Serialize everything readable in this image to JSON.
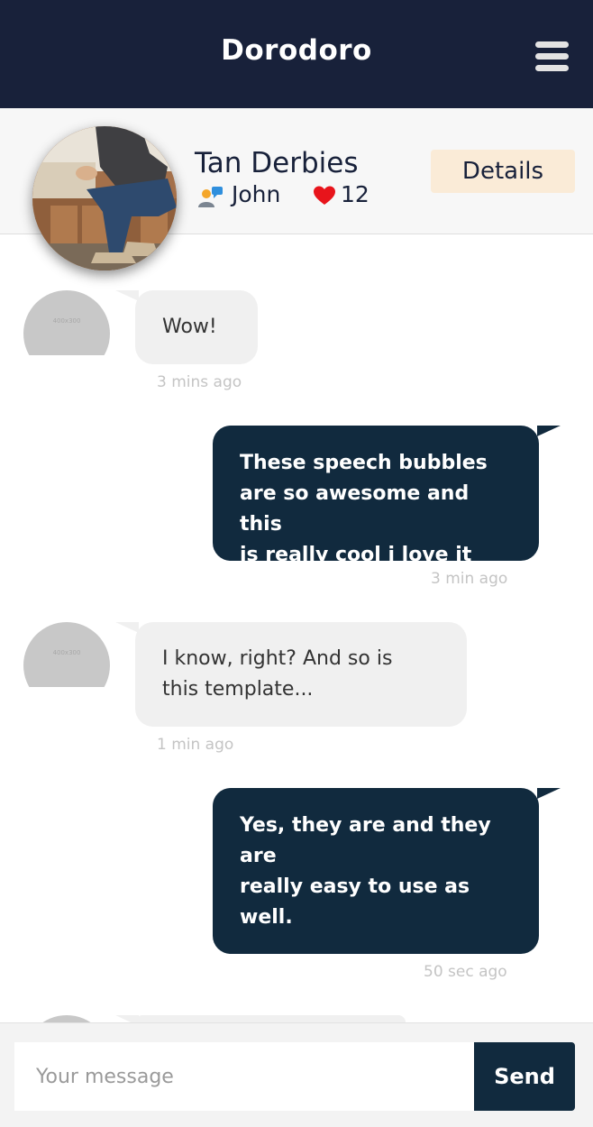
{
  "app": {
    "title": "Dorodoro"
  },
  "header": {
    "menu_icon": "hamburger-menu-icon"
  },
  "profile": {
    "name": "Tan Derbies",
    "user": "John",
    "likes": "12",
    "details_label": "Details",
    "user_icon": "people-icon",
    "likes_icon": "heart-icon"
  },
  "colors": {
    "navy": "#18213a",
    "bubble_out": "#112a3e",
    "bubble_in": "#f0f0f0",
    "details_bg": "#faebd7",
    "heart": "#e8141b"
  },
  "messages": [
    {
      "direction": "incoming",
      "avatar_placeholder": "400x300",
      "lines": [
        "Wow!"
      ],
      "time": "3 mins ago"
    },
    {
      "direction": "outgoing",
      "lines": [
        "These speech bubbles",
        "are so awesome and this",
        "is really cool i love it"
      ],
      "time": "3 min ago"
    },
    {
      "direction": "incoming",
      "avatar_placeholder": "400x300",
      "lines": [
        "I know, right? And so is",
        "this template..."
      ],
      "time": "1 min ago"
    },
    {
      "direction": "outgoing",
      "lines": [
        "Yes, they are and they",
        "are",
        "really easy to use as",
        "well."
      ],
      "time": "50 sec ago"
    }
  ],
  "composer": {
    "placeholder": "Your message",
    "send_label": "Send"
  }
}
